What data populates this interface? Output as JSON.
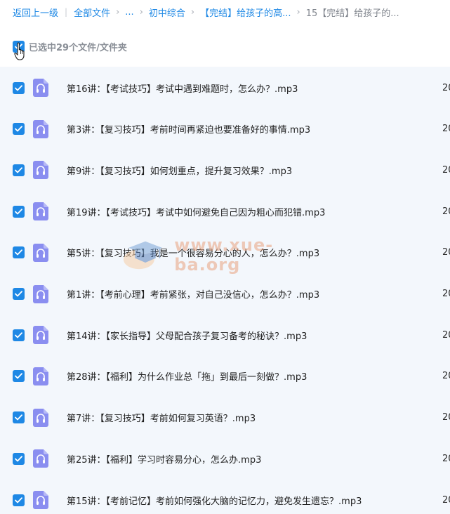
{
  "breadcrumb": {
    "back": "返回上一级",
    "all_files": "全部文件",
    "ellipsis": "...",
    "level1": "初中综合",
    "level2": "【完结】给孩子的高...",
    "current": "15【完结】给孩子的..."
  },
  "selection": {
    "label": "已选中29个文件/文件夹"
  },
  "files": [
    {
      "name": "第16讲：【考试技巧】考试中遇到难题时，怎么办？.mp3",
      "date": "20"
    },
    {
      "name": "第3讲：【复习技巧】考前时间再紧迫也要准备好的事情.mp3",
      "date": "20"
    },
    {
      "name": "第9讲：【复习技巧】如何划重点，提升复习效果？.mp3",
      "date": "20"
    },
    {
      "name": "第19讲：【考试技巧】考试中如何避免自己因为粗心而犯错.mp3",
      "date": "20"
    },
    {
      "name": "第5讲：【复习技巧】我是一个很容易分心的人，怎么办？.mp3",
      "date": "20"
    },
    {
      "name": "第1讲：【考前心理】考前紧张，对自己没信心，怎么办？.mp3",
      "date": "20"
    },
    {
      "name": "第14讲：【家长指导】父母配合孩子复习备考的秘诀？.mp3",
      "date": "20"
    },
    {
      "name": "第28讲：【福利】为什么作业总「拖」到最后一刻做？.mp3",
      "date": "20"
    },
    {
      "name": "第7讲：【复习技巧】考前如何复习英语？.mp3",
      "date": "20"
    },
    {
      "name": "第25讲：【福利】学习时容易分心，怎么办.mp3",
      "date": "20"
    },
    {
      "name": "第15讲：【考前记忆】考前如何强化大脑的记忆力，避免发生遗忘？.mp3",
      "date": "20"
    }
  ],
  "watermark": {
    "text": "www.xue-ba.org"
  },
  "colors": {
    "accent": "#1e88e5",
    "file_icon": "#8a8ef0",
    "list_bg": "#f3f7fc"
  }
}
